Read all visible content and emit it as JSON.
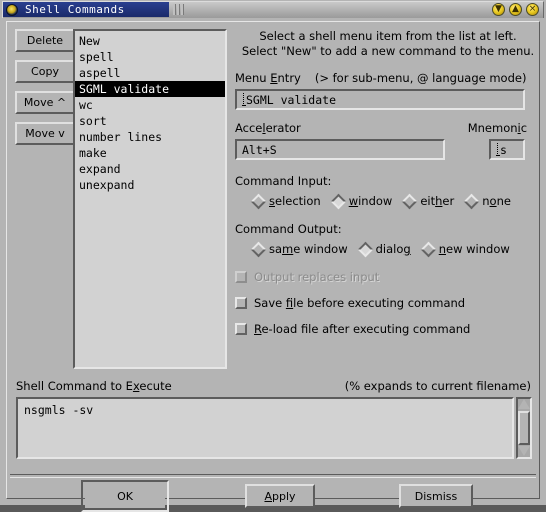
{
  "window": {
    "title": "Shell Commands",
    "icon": "app-menu-icon",
    "controls": [
      {
        "name": "minimize-button",
        "glyph": "▼"
      },
      {
        "name": "maximize-button",
        "glyph": "▲"
      },
      {
        "name": "close-button",
        "glyph": "×"
      }
    ]
  },
  "side_buttons": [
    {
      "label": "Delete",
      "name": "delete-button"
    },
    {
      "label": "Copy",
      "name": "copy-button"
    },
    {
      "label": "Move ^",
      "name": "move-up-button"
    },
    {
      "label": "Move v",
      "name": "move-down-button"
    }
  ],
  "list": {
    "items": [
      {
        "label": "New",
        "selected": false
      },
      {
        "label": "spell",
        "selected": false
      },
      {
        "label": "aspell",
        "selected": false
      },
      {
        "label": "SGML validate",
        "selected": true
      },
      {
        "label": "wc",
        "selected": false
      },
      {
        "label": "sort",
        "selected": false
      },
      {
        "label": "number lines",
        "selected": false
      },
      {
        "label": "make",
        "selected": false
      },
      {
        "label": "expand",
        "selected": false
      },
      {
        "label": "unexpand",
        "selected": false
      }
    ]
  },
  "help": {
    "line1": "Select a shell menu item from the list at left.",
    "line2": "Select \"New\" to add a new command to the menu."
  },
  "menu_entry": {
    "label_pre": "Menu ",
    "label_mnemonic": "E",
    "label_post": "ntry",
    "hint": "(> for sub-menu, @ language mode)",
    "value": "SGML validate",
    "placeholder": ""
  },
  "accelerator": {
    "label_pre": "Acce",
    "label_mnemonic": "l",
    "label_post": "erator",
    "value": "Alt+S",
    "placeholder": ""
  },
  "mnemonic": {
    "label_pre": "Mnemon",
    "label_mnemonic": "i",
    "label_post": "c",
    "value": "s",
    "placeholder": ""
  },
  "command_input": {
    "title": "Command Input:",
    "options": [
      {
        "pre": "",
        "mnemonic": "s",
        "post": "election",
        "selected": false,
        "name": "radio-input-selection"
      },
      {
        "pre": "",
        "mnemonic": "w",
        "post": "indow",
        "selected": true,
        "name": "radio-input-window"
      },
      {
        "pre": "eit",
        "mnemonic": "h",
        "post": "er",
        "selected": false,
        "name": "radio-input-either"
      },
      {
        "pre": "n",
        "mnemonic": "o",
        "post": "ne",
        "selected": false,
        "name": "radio-input-none"
      }
    ]
  },
  "command_output": {
    "title": "Command Output:",
    "options": [
      {
        "pre": "sa",
        "mnemonic": "m",
        "post": "e window",
        "selected": false,
        "name": "radio-output-same-window"
      },
      {
        "pre": "dialo",
        "mnemonic": "g",
        "post": "",
        "selected": true,
        "name": "radio-output-dialog"
      },
      {
        "pre": "",
        "mnemonic": "n",
        "post": "ew window",
        "selected": false,
        "name": "radio-output-new-window"
      }
    ]
  },
  "checkboxes": [
    {
      "pre": "Output replaces input",
      "mnemonic": "",
      "post": "",
      "checked": false,
      "disabled": true,
      "name": "checkbox-output-replaces-input"
    },
    {
      "pre": "Save ",
      "mnemonic": "f",
      "post": "ile before executing command",
      "checked": false,
      "disabled": false,
      "name": "checkbox-save-file-before"
    },
    {
      "pre": "",
      "mnemonic": "R",
      "post": "e-load file after executing command",
      "checked": false,
      "disabled": false,
      "name": "checkbox-reload-file-after"
    }
  ],
  "command_area": {
    "label_pre": "Shell Command to E",
    "label_mnemonic": "x",
    "label_post": "ecute",
    "hint": "(% expands to current filename)",
    "value": "nsgmls -sv",
    "placeholder": ""
  },
  "bottom_buttons": [
    {
      "pre": "OK",
      "mnemonic": "",
      "post": "",
      "name": "ok-button",
      "default": true
    },
    {
      "pre": "",
      "mnemonic": "A",
      "post": "pply",
      "name": "apply-button",
      "default": false
    },
    {
      "pre": "Dismiss",
      "mnemonic": "",
      "post": "",
      "name": "dismiss-button",
      "default": false
    }
  ],
  "colors": {
    "dialog_bg": "#b4b4b4",
    "field_bg": "#d2d2d2",
    "titlebar_active": "#2a3f8f",
    "selection_bg": "#000000",
    "selection_fg": "#ffffff"
  }
}
